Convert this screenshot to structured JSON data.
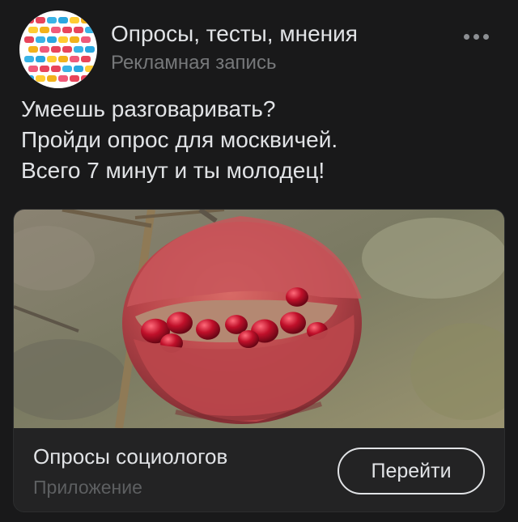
{
  "header": {
    "group_name": "Опросы, тесты, мнения",
    "subtitle": "Рекламная запись",
    "more_icon": "more-horizontal-icon"
  },
  "post": {
    "lines": [
      "Умеешь разговаривать?",
      "Пройди опрос для москвичей.",
      "Всего 7 минут и ты молодец!"
    ]
  },
  "card": {
    "title": "Опросы социологов",
    "subtitle": "Приложение",
    "button_label": "Перейти"
  },
  "colors": {
    "background": "#19191a",
    "text_primary": "#e1e3e6",
    "text_secondary": "#76787a",
    "card_background": "#232324"
  }
}
